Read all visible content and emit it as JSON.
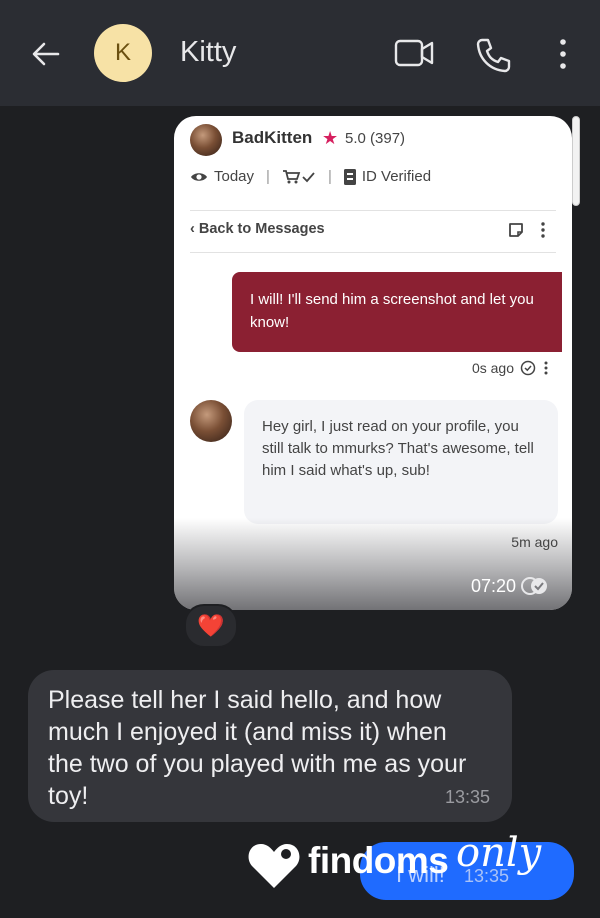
{
  "header": {
    "avatar_initial": "K",
    "contact_name": "Kitty"
  },
  "screenshot": {
    "seller_name": "BadKitten",
    "rating": "5.0",
    "rating_count": "(397)",
    "seen": "Today",
    "verified": "ID Verified",
    "back_label": "Back to Messages",
    "outgoing_text": "I will! I'll send him a screenshot and let you know!",
    "outgoing_time": "0s ago",
    "incoming_text": "Hey girl, I just read on your profile, you still talk to mmurks? That's awesome, tell him I said what's up, sub!",
    "incoming_time": "5m ago",
    "bubble_time": "07:20"
  },
  "reaction": "❤️",
  "message": {
    "text": "Please tell her I said hello, and how much I enjoyed it (and miss it) when the two of you played with me as your toy!",
    "time": "13:35"
  },
  "partial_message": {
    "text": "I will!",
    "time": "13:35"
  },
  "watermark": {
    "word": "findoms",
    "script": "only"
  },
  "colors": {
    "background": "#1e1f22",
    "topbar": "#2b2d33",
    "avatar": "#f7e2a6",
    "accent_red": "#8b2032",
    "star": "#d6205f",
    "incoming_bubble": "#35363b",
    "outgoing_bubble": "#1f6bff"
  }
}
